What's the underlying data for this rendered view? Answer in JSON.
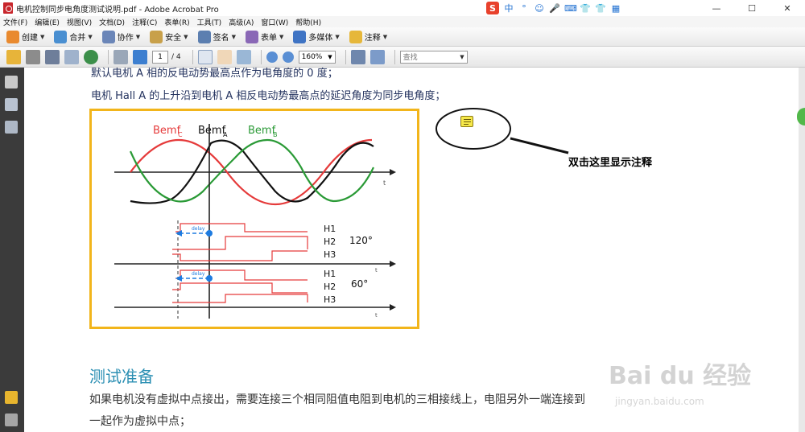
{
  "window": {
    "title": "电机控制同步电角度测试说明.pdf - Adobe Acrobat Pro",
    "min_label": "—",
    "max_label": "☐",
    "close_label": "✕"
  },
  "ime": {
    "logo": "S",
    "glyphs": [
      "中",
      "°",
      "☺",
      "🎤",
      "⌨",
      "👕",
      "👕",
      "▦"
    ]
  },
  "menu": [
    "文件(F)",
    "编辑(E)",
    "视图(V)",
    "文档(D)",
    "注释(C)",
    "表单(R)",
    "工具(T)",
    "高级(A)",
    "窗口(W)",
    "帮助(H)"
  ],
  "toolbar": {
    "buttons": [
      {
        "label": "创建",
        "color": "#e98a2f"
      },
      {
        "label": "合并",
        "color": "#4a8fd1"
      },
      {
        "label": "协作",
        "color": "#6b86b8"
      },
      {
        "label": "安全",
        "color": "#c8a04a"
      },
      {
        "label": "签名",
        "color": "#5c7fb0"
      },
      {
        "label": "表单",
        "color": "#8a68b6"
      },
      {
        "label": "多媒体",
        "color": "#3f74c4"
      },
      {
        "label": "注释",
        "color": "#e6b73a"
      }
    ],
    "page_current": "1",
    "page_total": "/ 4",
    "zoom": "160%",
    "find_placeholder": "查找"
  },
  "document": {
    "line1": "默认电机 A 相的反电动势最高点作为电角度的 0 度；",
    "line2": "电机 Hall A 的上升沿到电机 A 相反电动势最高点的延迟角度为同步电角度；",
    "heading": "测试准备",
    "para1": "如果电机没有虚拟中点接出，需要连接三个相同阻值电阻到电机的三相接线上，电阻另外一端连接到",
    "para2": "一起作为虚拟中点；",
    "annotation_text": "双击这里显示注释"
  },
  "figure": {
    "labels": {
      "bemf_c": "Bemf",
      "bemf_c_sub": "C",
      "bemf_a": "Bemf",
      "bemf_a_sub": "A",
      "bemf_b": "Bemf",
      "bemf_b_sub": "B",
      "t": "t",
      "h1": "H1",
      "h2": "H2",
      "h3": "H3",
      "deg120": "120°",
      "deg60": "60°",
      "delay": "delay"
    },
    "colors": {
      "c": "#e53a3a",
      "a": "#111111",
      "b": "#2a9a36",
      "delay": "#1e7be0"
    }
  },
  "watermark": {
    "main": "Bai du 经验",
    "sub": "jingyan.baidu.com"
  }
}
